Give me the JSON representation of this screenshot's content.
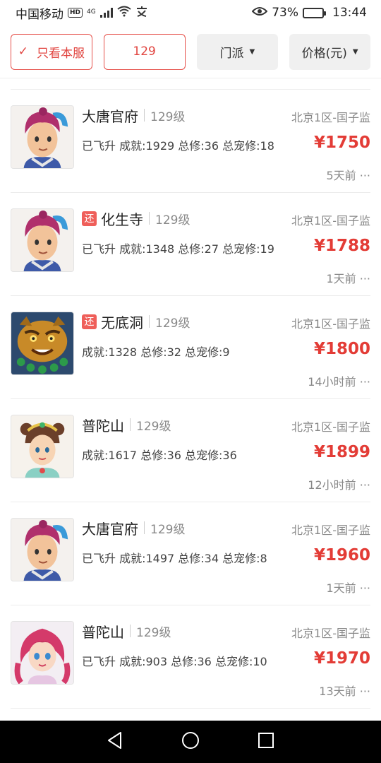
{
  "status": {
    "carrier": "中国移动",
    "hd": "HD",
    "network": "4G",
    "battery_pct": "73%",
    "battery_level": 0.73,
    "time": "13:44"
  },
  "filters": {
    "only_server": "只看本服",
    "level": "129",
    "sect": "门派",
    "price": "价格(元)"
  },
  "listings": [
    {
      "tag": "",
      "sect": "大唐官府",
      "level": "129级",
      "server": "北京1区-国子监",
      "desc": "已飞升 成就:1929 总修:36 总宠修:18",
      "price": "¥1750",
      "time": "5天前 ···",
      "avatar": "datang"
    },
    {
      "tag": "还",
      "sect": "化生寺",
      "level": "129级",
      "server": "北京1区-国子监",
      "desc": "已飞升 成就:1348 总修:27 总宠修:19",
      "price": "¥1788",
      "time": "1天前 ···",
      "avatar": "datang"
    },
    {
      "tag": "还",
      "sect": "无底洞",
      "level": "129级",
      "server": "北京1区-国子监",
      "desc": "成就:1328 总修:32 总宠修:9",
      "price": "¥1800",
      "time": "14小时前 ···",
      "avatar": "tiger"
    },
    {
      "tag": "",
      "sect": "普陀山",
      "level": "129级",
      "server": "北京1区-国子监",
      "desc": "成就:1617 总修:36 总宠修:36",
      "price": "¥1899",
      "time": "12小时前 ···",
      "avatar": "putuo"
    },
    {
      "tag": "",
      "sect": "大唐官府",
      "level": "129级",
      "server": "北京1区-国子监",
      "desc": "已飞升 成就:1497 总修:34 总宠修:8",
      "price": "¥1960",
      "time": "1天前 ···",
      "avatar": "datang"
    },
    {
      "tag": "",
      "sect": "普陀山",
      "level": "129级",
      "server": "北京1区-国子监",
      "desc": "已飞升 成就:903 总修:36 总宠修:10",
      "price": "¥1970",
      "time": "13天前 ···",
      "avatar": "girl"
    }
  ],
  "nav": {
    "back": "back-icon",
    "home": "home-icon",
    "recents": "recents-icon"
  }
}
